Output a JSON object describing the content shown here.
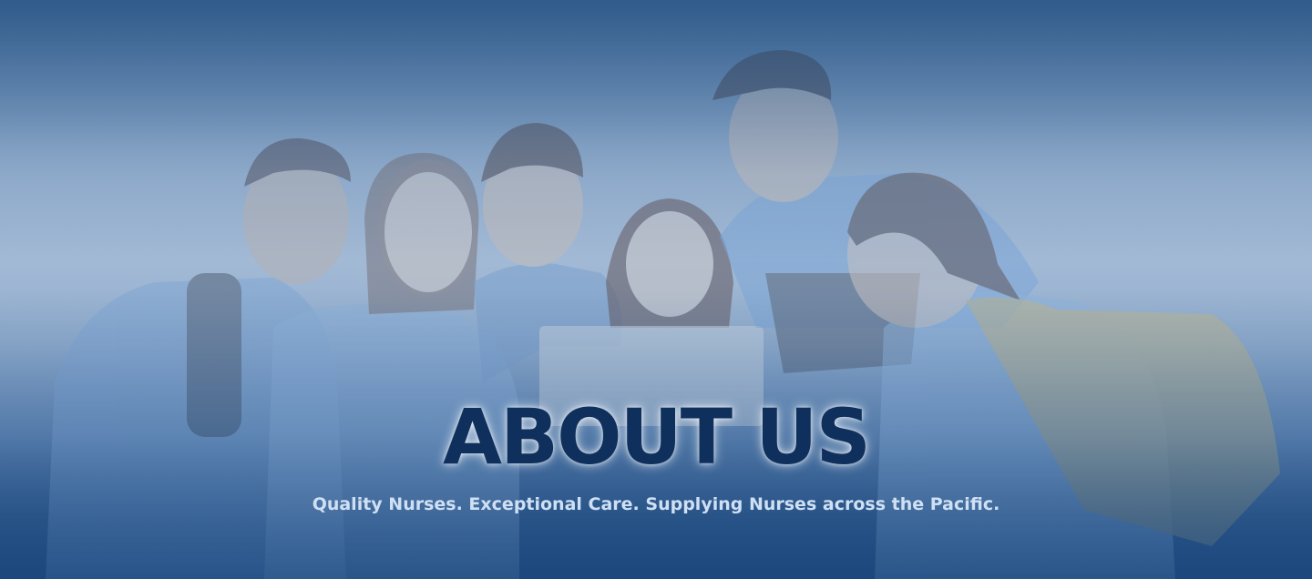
{
  "hero": {
    "title": "ABOUT US",
    "tagline": "Quality Nurses. Exceptional Care. Supplying Nurses across the Pacific.",
    "image_description_icon": "group-of-nurses-photo",
    "colors": {
      "title": "#0f2f5c",
      "tagline": "#cfe0f4",
      "top": "#3a6490",
      "bottom": "#1f4a7e"
    }
  }
}
